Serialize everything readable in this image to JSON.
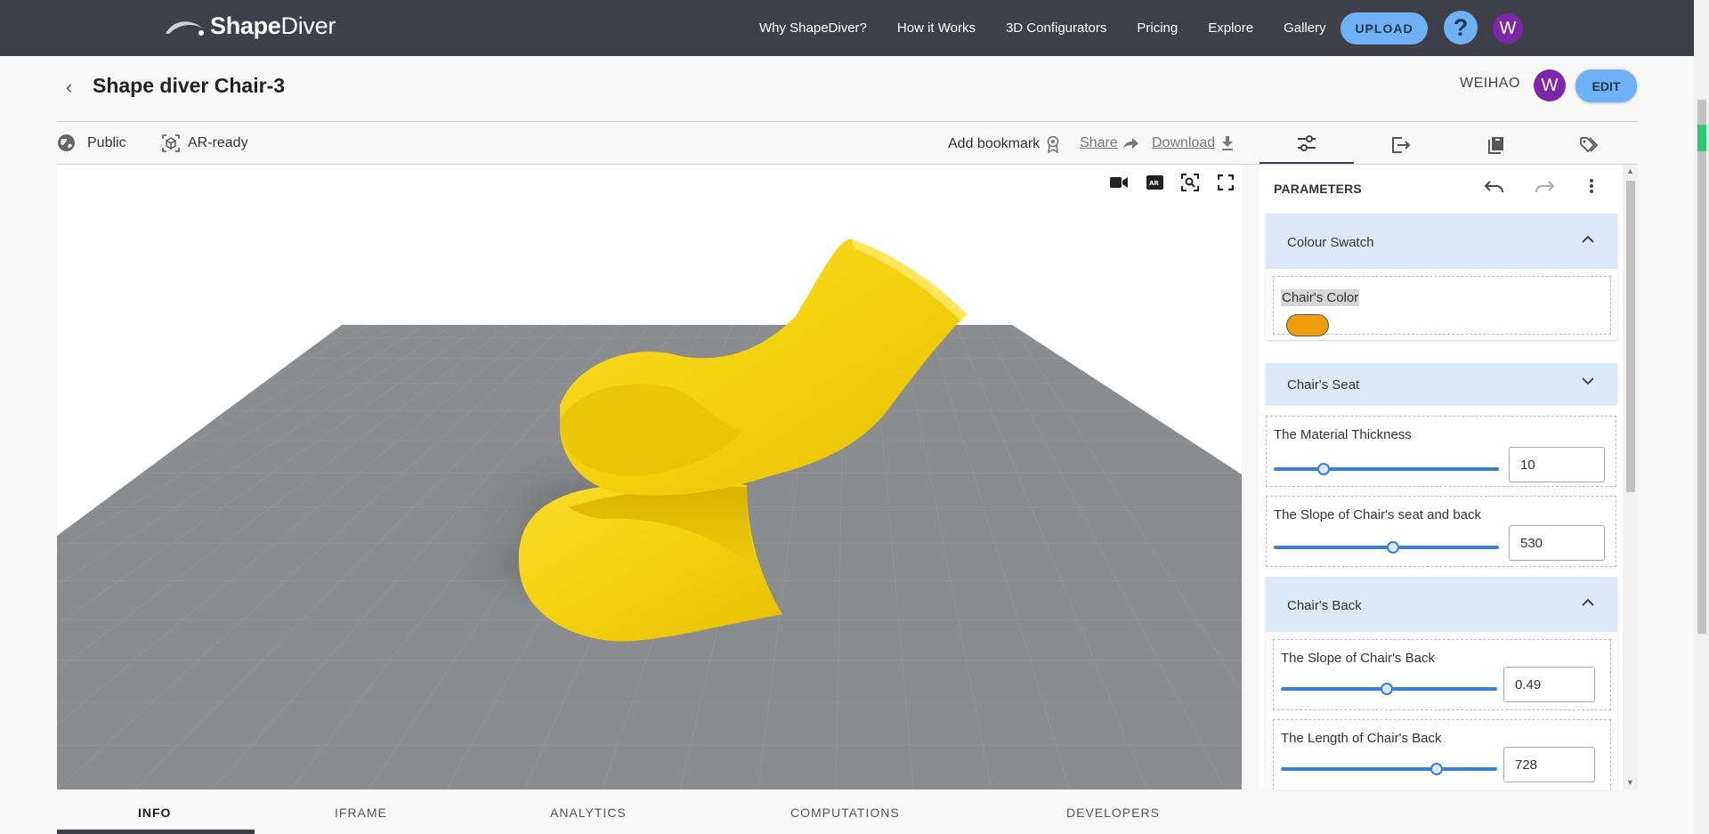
{
  "brand": {
    "part1": "Shape",
    "part2": "Diver"
  },
  "nav": {
    "links": [
      "Why ShapeDiver?",
      "How it Works",
      "3D Configurators",
      "Pricing",
      "Explore",
      "Gallery"
    ],
    "upload_label": "UPLOAD",
    "help_label": "?",
    "avatar_initial": "W"
  },
  "header": {
    "title": "Shape diver Chair-3",
    "owner": "WEIHAO",
    "owner_initial": "W",
    "edit_label": "EDIT"
  },
  "subbar": {
    "visibility": "Public",
    "ar": "AR-ready",
    "bookmark": "Add bookmark",
    "share": "Share",
    "download": "Download"
  },
  "panel": {
    "title": "PARAMETERS",
    "groups": {
      "swatch": {
        "label": "Colour Swatch",
        "state": "expanded"
      },
      "seat": {
        "label": "Chair's Seat",
        "state": "collapsed"
      },
      "back": {
        "label": "Chair's Back",
        "state": "expanded"
      }
    },
    "params": {
      "color": {
        "name": "Chair's Color",
        "value": "#ed9d0d"
      },
      "thickness": {
        "name": "The Material Thickness",
        "value": "10",
        "fraction": 0.22
      },
      "seat_slope": {
        "name": "The Slope of Chair's seat and back",
        "value": "530",
        "fraction": 0.53
      },
      "back_slope": {
        "name": "The Slope of Chair's Back",
        "value": "0.49",
        "fraction": 0.49
      },
      "back_length": {
        "name": "The Length of Chair's Back",
        "value": "728",
        "fraction": 0.72
      }
    }
  },
  "bottom_tabs": [
    "INFO",
    "IFRAME",
    "ANALYTICS",
    "COMPUTATIONS",
    "DEVELOPERS"
  ],
  "colors": {
    "nav_bg": "#3e3f49",
    "accent": "#6fb1f5",
    "avatar": "#7b27a8",
    "chair": "#f5d311",
    "ground": "#8a8c8d",
    "slider": "#3b7fd4",
    "group_bg": "#dbe9fb"
  }
}
